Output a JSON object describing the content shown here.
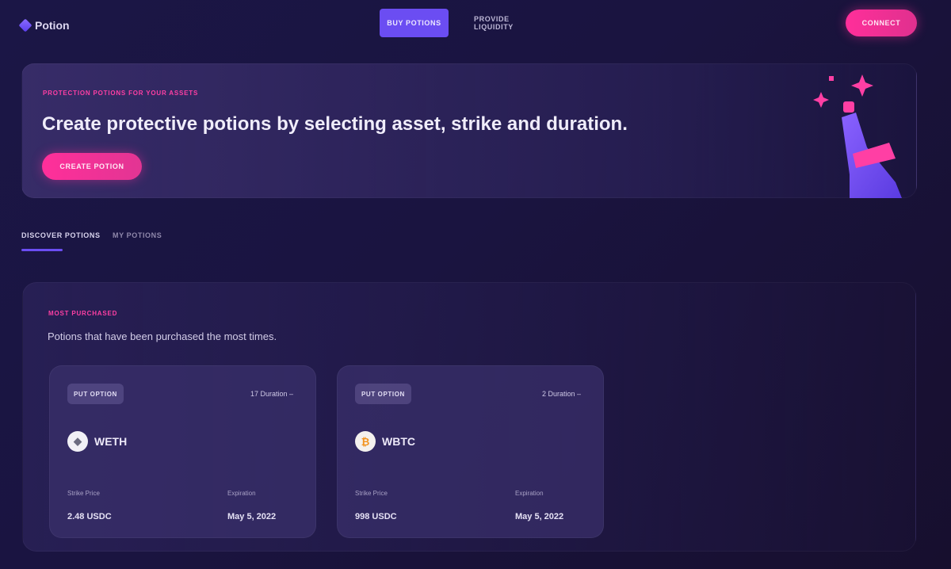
{
  "header": {
    "logo_text": "Potion",
    "nav": [
      {
        "label": "BUY POTIONS",
        "active": true
      },
      {
        "label": "PROVIDE LIQUIDITY",
        "active": false
      }
    ],
    "connect_label": "CONNECT"
  },
  "hero": {
    "eyebrow": "PROTECTION POTIONS FOR YOUR ASSETS",
    "title": "Create protective potions by selecting asset, strike and duration.",
    "cta_label": "CREATE POTION"
  },
  "tabs": [
    {
      "label": "DISCOVER POTIONS",
      "active": true
    },
    {
      "label": "MY POTIONS",
      "active": false
    }
  ],
  "section": {
    "eyebrow": "MOST PURCHASED",
    "description": "Potions that have been purchased the most times."
  },
  "cards": [
    {
      "badge": "PUT OPTION",
      "duration": "17 Duration –",
      "asset": "WETH",
      "icon": "eth-icon",
      "strike_label": "Strike Price",
      "strike_value": "2.48 USDC",
      "expiration_label": "Expiration",
      "expiration_value": "May 5, 2022"
    },
    {
      "badge": "PUT OPTION",
      "duration": "2 Duration –",
      "asset": "WBTC",
      "icon": "btc-icon",
      "strike_label": "Strike Price",
      "strike_value": "998 USDC",
      "expiration_label": "Expiration",
      "expiration_value": "May 5, 2022"
    }
  ],
  "colors": {
    "accent_purple": "#6b4df2",
    "accent_pink": "#ff2f9a",
    "background": "#1b1646"
  }
}
